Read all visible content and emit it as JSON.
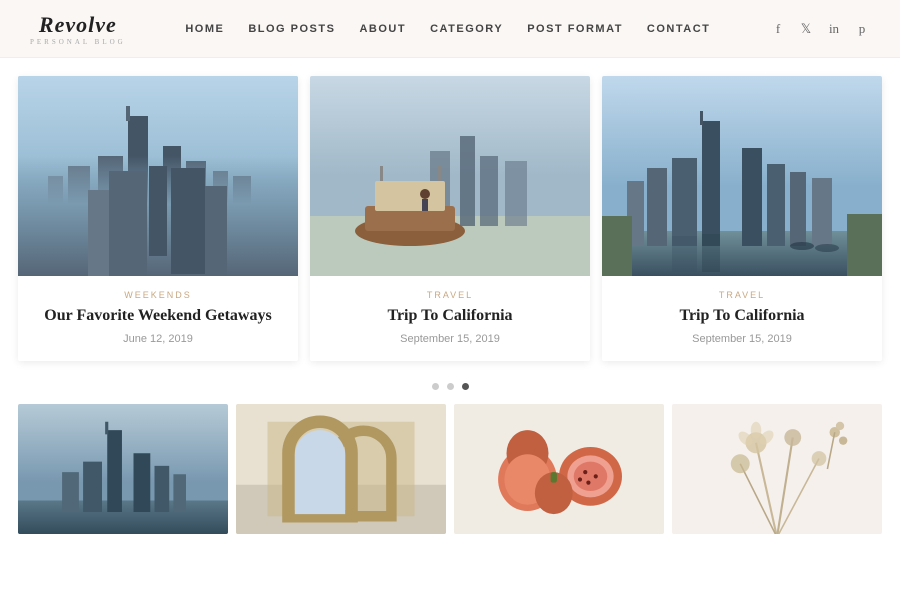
{
  "header": {
    "logo_name": "Revolve",
    "logo_tagline": "PERSONAL BLOG",
    "nav": [
      {
        "label": "HOME",
        "id": "nav-home"
      },
      {
        "label": "BLOG POSTS",
        "id": "nav-blog"
      },
      {
        "label": "ABOUT",
        "id": "nav-about"
      },
      {
        "label": "CATEGORY",
        "id": "nav-category"
      },
      {
        "label": "POST FORMAT",
        "id": "nav-post-format"
      },
      {
        "label": "CONTACT",
        "id": "nav-contact"
      }
    ],
    "social": [
      {
        "icon": "f",
        "name": "facebook-icon"
      },
      {
        "icon": "✦",
        "name": "twitter-icon"
      },
      {
        "icon": "in",
        "name": "linkedin-icon"
      },
      {
        "icon": "𝐩",
        "name": "pinterest-icon"
      }
    ]
  },
  "featured_cards": [
    {
      "category": "WEEKENDS",
      "title": "Our Favorite Weekend Getaways",
      "date": "June 12, 2019"
    },
    {
      "category": "TRAVEL",
      "title": "Trip To California",
      "date": "September 15, 2019"
    },
    {
      "category": "TRAVEL",
      "title": "Trip To California",
      "date": "September 15, 2019"
    }
  ],
  "dots": [
    {
      "active": false
    },
    {
      "active": false
    },
    {
      "active": true
    }
  ],
  "grid_images": [
    {
      "alt": "city skyline"
    },
    {
      "alt": "arches architecture"
    },
    {
      "alt": "figs fruit"
    },
    {
      "alt": "dried flowers"
    }
  ]
}
